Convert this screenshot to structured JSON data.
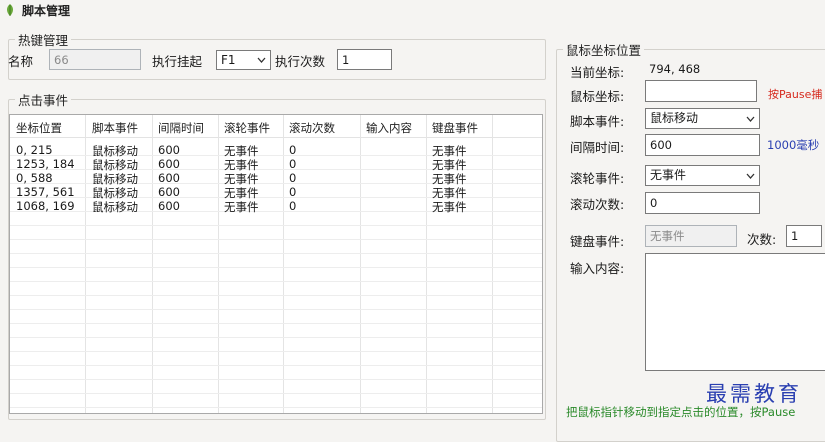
{
  "window": {
    "title": "脚本管理"
  },
  "hotkey": {
    "legend": "热键管理",
    "name_label": "名称",
    "name_value": "66",
    "exec_label": "执行挂起",
    "exec_key": "F1",
    "count_label": "执行次数",
    "count_value": "1"
  },
  "click_events": {
    "legend": "点击事件",
    "columns": [
      "坐标位置",
      "脚本事件",
      "间隔时间",
      "滚轮事件",
      "滚动次数",
      "输入内容",
      "键盘事件"
    ],
    "rows": [
      [
        "0, 215",
        "鼠标移动",
        "600",
        "无事件",
        "0",
        "",
        "无事件"
      ],
      [
        "1253, 184",
        "鼠标移动",
        "600",
        "无事件",
        "0",
        "",
        "无事件"
      ],
      [
        "0, 588",
        "鼠标移动",
        "600",
        "无事件",
        "0",
        "",
        "无事件"
      ],
      [
        "1357, 561",
        "鼠标移动",
        "600",
        "无事件",
        "0",
        "",
        "无事件"
      ],
      [
        "1068, 169",
        "鼠标移动",
        "600",
        "无事件",
        "0",
        "",
        "无事件"
      ]
    ]
  },
  "mouse": {
    "legend": "鼠标坐标位置",
    "current_label": "当前坐标:",
    "current_value": "794, 468",
    "coord_label": "鼠标坐标:",
    "coord_value": "",
    "coord_hint": "按Pause捕",
    "script_event_label": "脚本事件:",
    "script_event_value": "鼠标移动",
    "interval_label": "间隔时间:",
    "interval_value": "600",
    "interval_hint": "1000毫秒",
    "wheel_label": "滚轮事件:",
    "wheel_value": "无事件",
    "scroll_label": "滚动次数:",
    "scroll_value": "0",
    "key_label": "键盘事件:",
    "key_value": "无事件",
    "times_label": "次数:",
    "times_value": "1",
    "input_label": "输入内容:",
    "input_value": ""
  },
  "watermark": "最需教育",
  "bottom_hint": "把鼠标指针移动到指定点击的位置，按Pause",
  "colors": {
    "hint_red": "#d62a1e",
    "hint_blue": "#2a3fb1",
    "hint_green": "#2a8a2a"
  }
}
